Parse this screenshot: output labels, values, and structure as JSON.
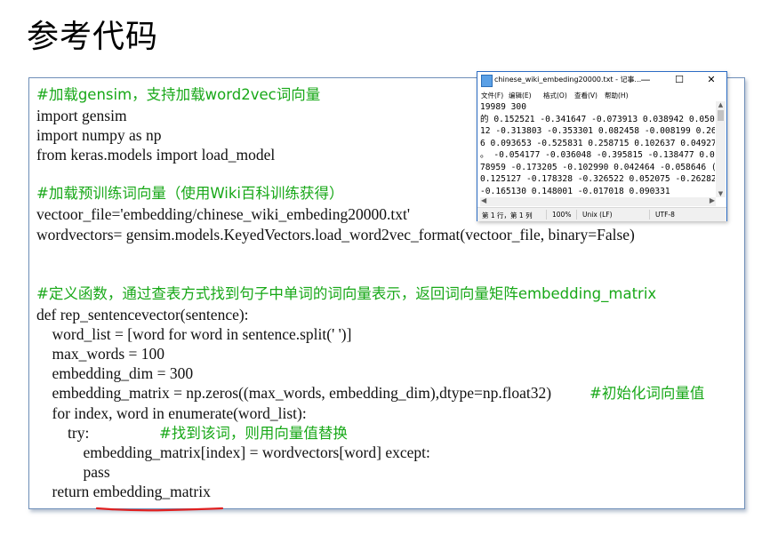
{
  "slide": {
    "title": "参考代码"
  },
  "code": {
    "lines": [
      "#加载gensim，支持加载word2vec词向量",
      "import gensim",
      "import numpy as np",
      "from keras.models import load_model",
      "",
      "#加载预训练词向量（使用Wiki百科训练获得）",
      "vectoor_file='embedding/chinese_wiki_embeding20000.txt'",
      "wordvectors= gensim.models.KeyedVectors.load_word2vec_format(vectoor_file, binary=False)",
      "",
      "",
      "#定义函数，通过查表方式找到句子中单词的词向量表示，返回词向量矩阵embedding_matrix",
      "def rep_sentencevector(sentence):",
      "    word_list = [word for word in sentence.split(' ')]",
      "    max_words = 100",
      "    embedding_dim = 300",
      "    embedding_matrix = np.zeros((max_words, embedding_dim),dtype=np.float32)",
      "#初始化词向量值",
      "    for index, word in enumerate(word_list):",
      "        try:",
      "#找到该词，则用向量值替换",
      "            embedding_matrix[index] = wordvectors[word] except:",
      "            pass",
      "    return embedding_matrix"
    ]
  },
  "notepad": {
    "title": "chinese_wiki_embeding20000.txt - 记事...",
    "controls": {
      "minimize": "—",
      "maximize": "☐",
      "close": "✕"
    },
    "menu": [
      "文件(F)",
      "编辑(E)",
      "格式(O)",
      "查看(V)",
      "帮助(H)"
    ],
    "text_lines": [
      "19989 300",
      "的 0.152521 -0.341647 -0.073913 0.038942 0.050",
      "12 -0.313803 -0.353301 0.082458 -0.008199 0.26",
      "6 0.093653 -0.525831 0.258715 0.102637 0.04927",
      "。 -0.054177 -0.036048 -0.395815 -0.138477 0.07",
      "78959 -0.173205 -0.102990 0.042464 -0.058646 (",
      "0.125127 -0.178328 -0.326522 0.052075 -0.26282",
      "-0.165130 0.148001 -0.017018 0.090331"
    ],
    "status": {
      "position": "第 1 行，第 1 列",
      "zoom": "100%",
      "line_ending": "Unix (LF)",
      "encoding": "UTF-8"
    }
  },
  "colors": {
    "comment": "#18a818",
    "underline": "#e02020",
    "box_border": "#6f8fb8",
    "notepad_border": "#2b6cc4"
  }
}
